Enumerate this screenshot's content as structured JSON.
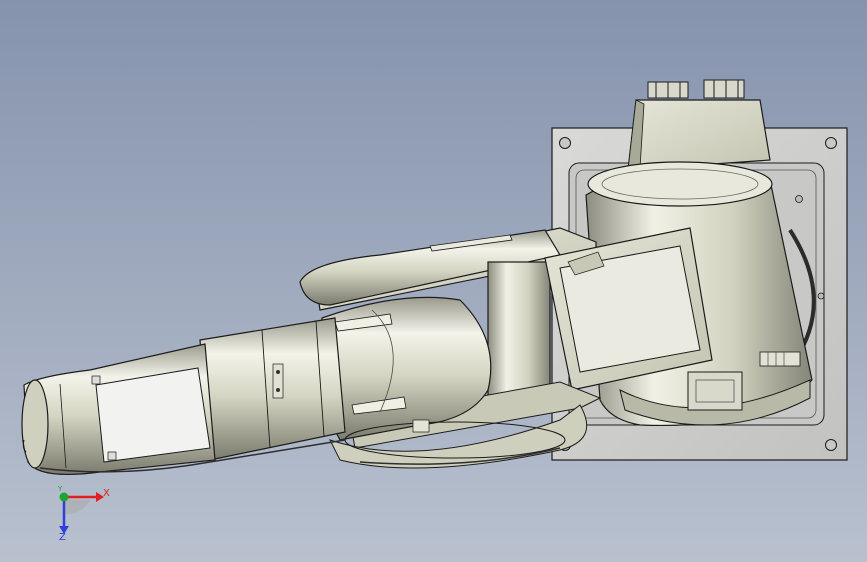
{
  "viewport": {
    "background_top": "#8593ad",
    "background_bottom": "#b9c1cf"
  },
  "model": {
    "type": "scara-robot-arm",
    "body_color": "#d8d8c6",
    "shade_color": "#8e8e80",
    "highlight_color": "#f3f3ea",
    "edge_color": "#1b1b1b",
    "base_plate_color": "#cfcfcd",
    "window_color": "#f2f2f2",
    "shadow_color": "#2e2e2e"
  },
  "triad": {
    "x_label": "X",
    "y_label": "Y",
    "z_label": "Z",
    "x_color": "#e02020",
    "y_color": "#1fa52f",
    "z_color": "#2f3fd8"
  }
}
